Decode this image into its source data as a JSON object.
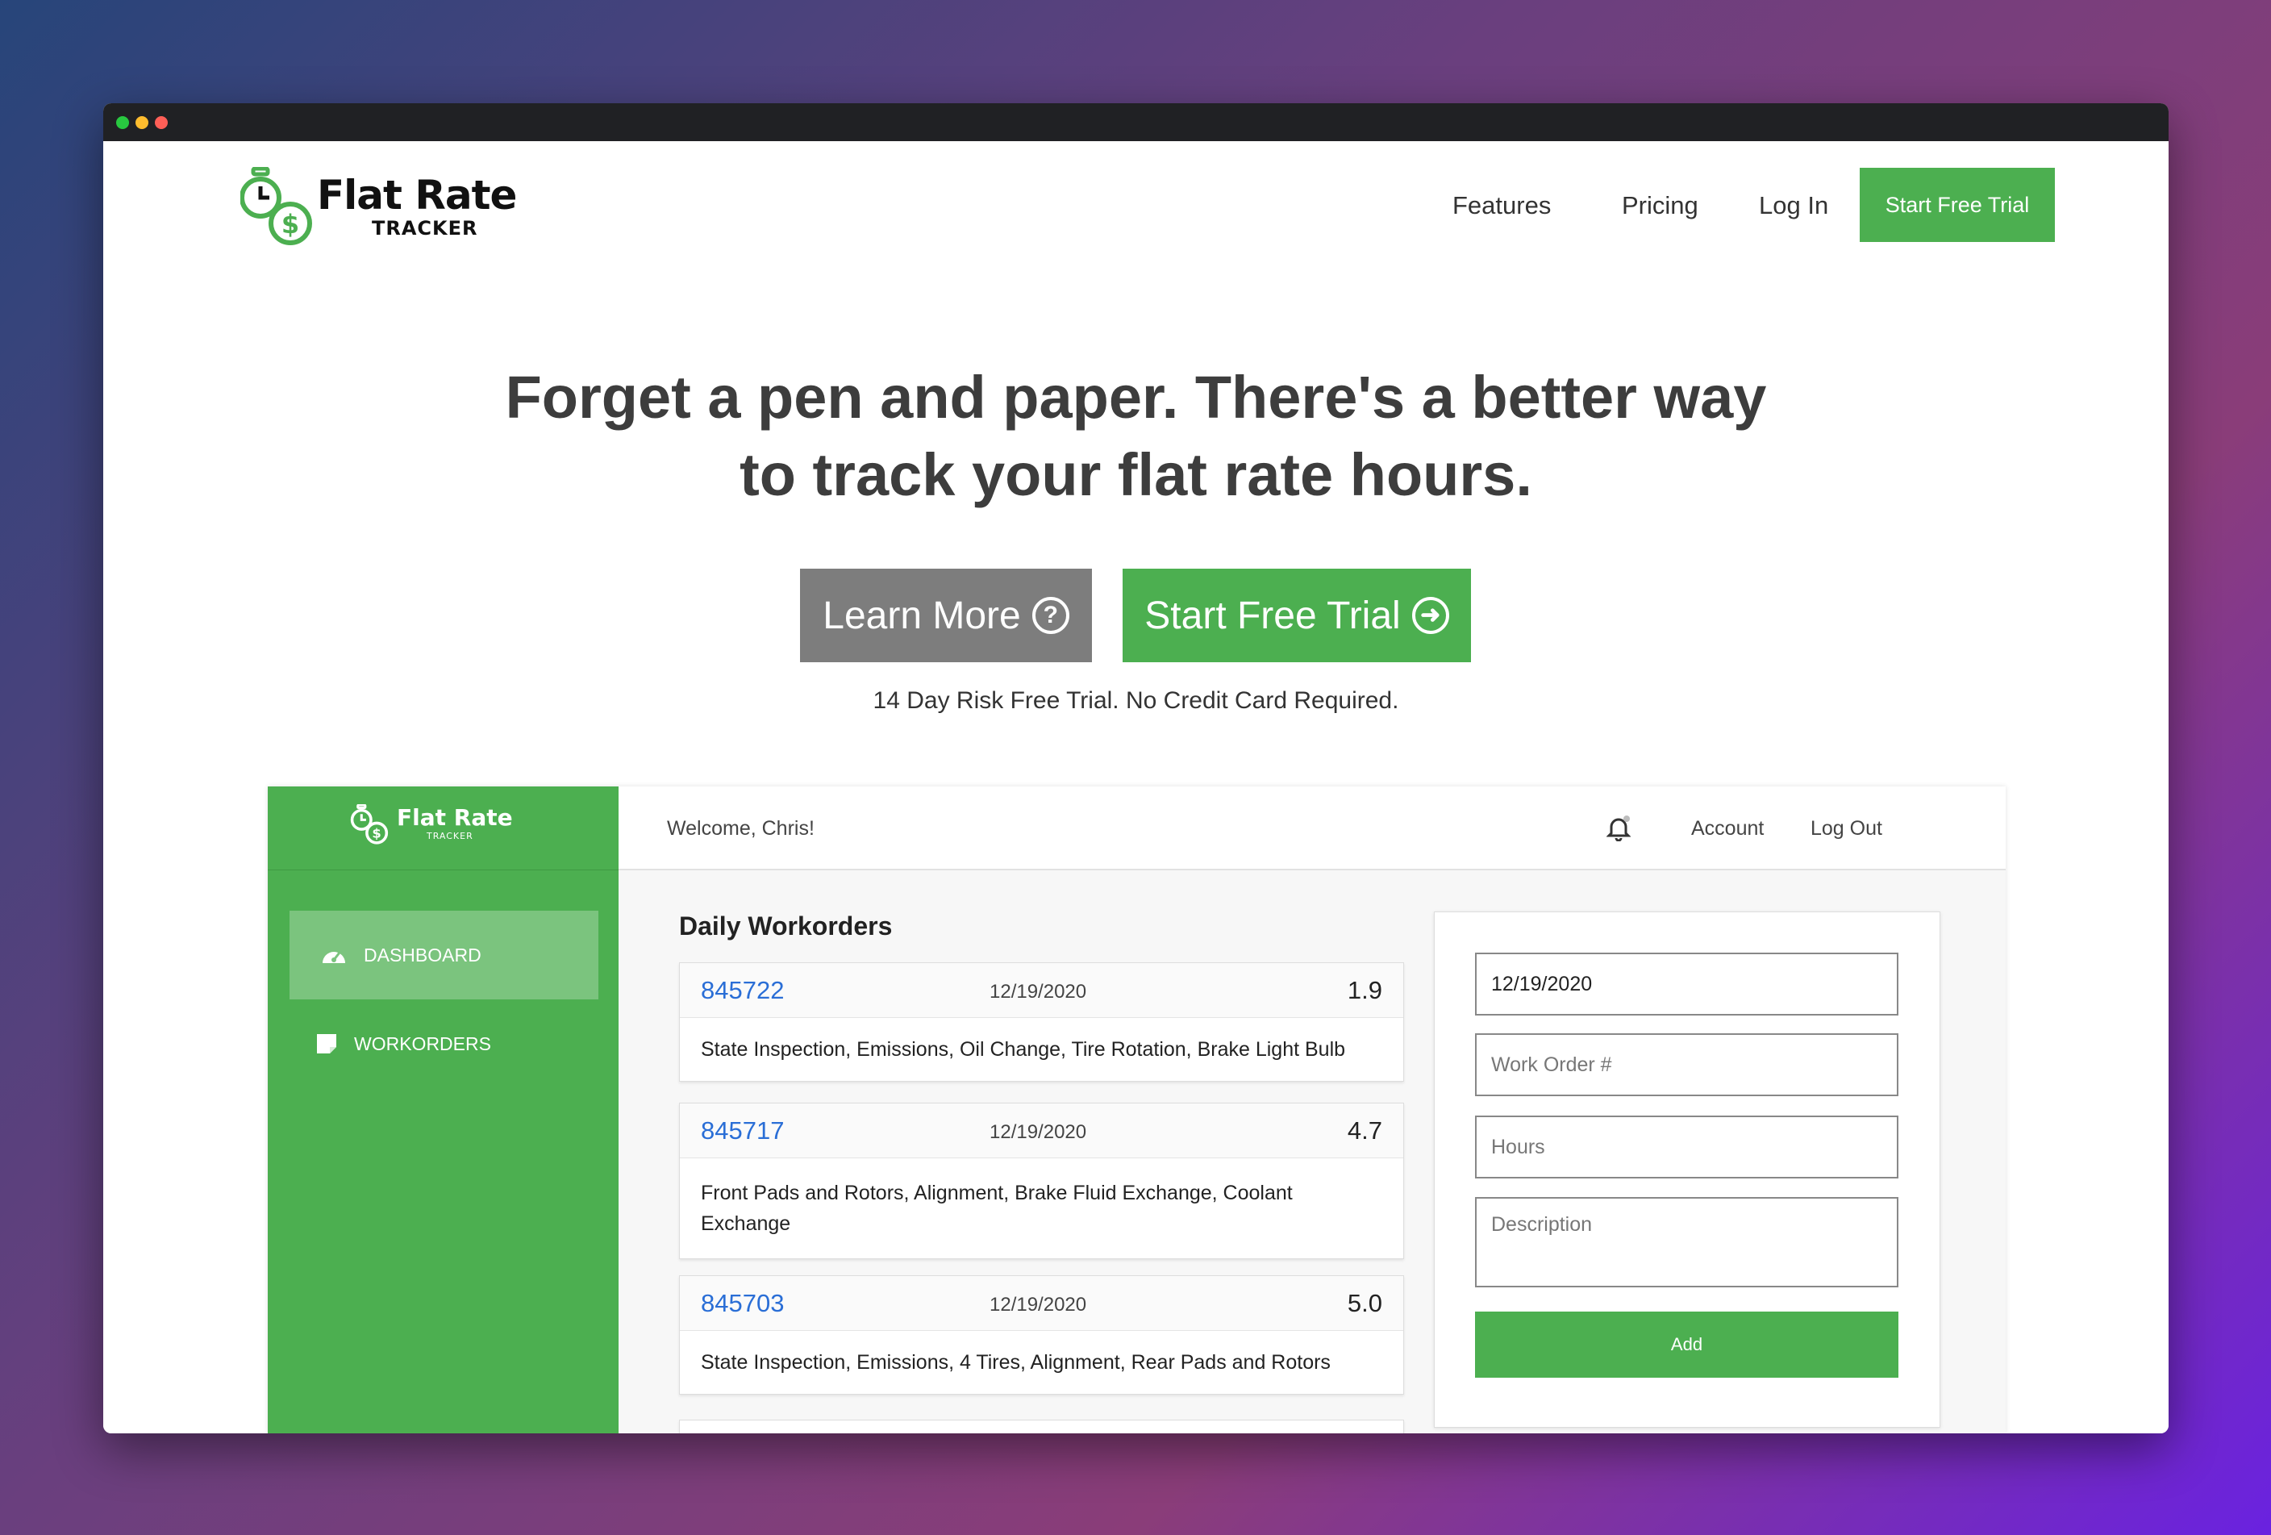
{
  "colors": {
    "brand_green": "#4caf50",
    "learn_gray": "#7d7d7d",
    "link_blue": "#2a6ed6",
    "heading": "#3d3d3d"
  },
  "site": {
    "logo_title": "Flat Rate",
    "logo_subtitle": "TRACKER",
    "nav": {
      "features": "Features",
      "pricing": "Pricing",
      "login": "Log In",
      "cta": "Start Free Trial"
    }
  },
  "hero": {
    "title_line1": "Forget a pen and paper. There's a better way",
    "title_line2": "to track your flat rate hours.",
    "learn_more": "Learn More",
    "learn_icon": "question-circle-icon",
    "start_trial": "Start Free Trial",
    "trial_icon": "arrow-right-circle-icon",
    "note": "14 Day Risk Free Trial. No Credit Card Required."
  },
  "app": {
    "logo_title": "Flat Rate",
    "logo_subtitle": "TRACKER",
    "sidebar": [
      {
        "label": "DASHBOARD",
        "icon": "dashboard-gauge-icon",
        "active": true
      },
      {
        "label": "WORKORDERS",
        "icon": "note-icon",
        "active": false
      }
    ],
    "welcome": "Welcome, Chris!",
    "account": "Account",
    "logout": "Log Out",
    "panel_title": "Daily Workorders",
    "workorders": [
      {
        "number": "845722",
        "date": "12/19/2020",
        "hours": "1.9",
        "description": "State Inspection, Emissions, Oil Change, Tire Rotation, Brake Light Bulb"
      },
      {
        "number": "845717",
        "date": "12/19/2020",
        "hours": "4.7",
        "description": "Front Pads and Rotors, Alignment, Brake Fluid Exchange, Coolant Exchange"
      },
      {
        "number": "845703",
        "date": "12/19/2020",
        "hours": "5.0",
        "description": "State Inspection, Emissions, 4 Tires, Alignment, Rear Pads and Rotors"
      }
    ],
    "form": {
      "date_value": "12/19/2020",
      "work_order_placeholder": "Work Order #",
      "hours_placeholder": "Hours",
      "description_placeholder": "Description",
      "add_label": "Add"
    }
  }
}
